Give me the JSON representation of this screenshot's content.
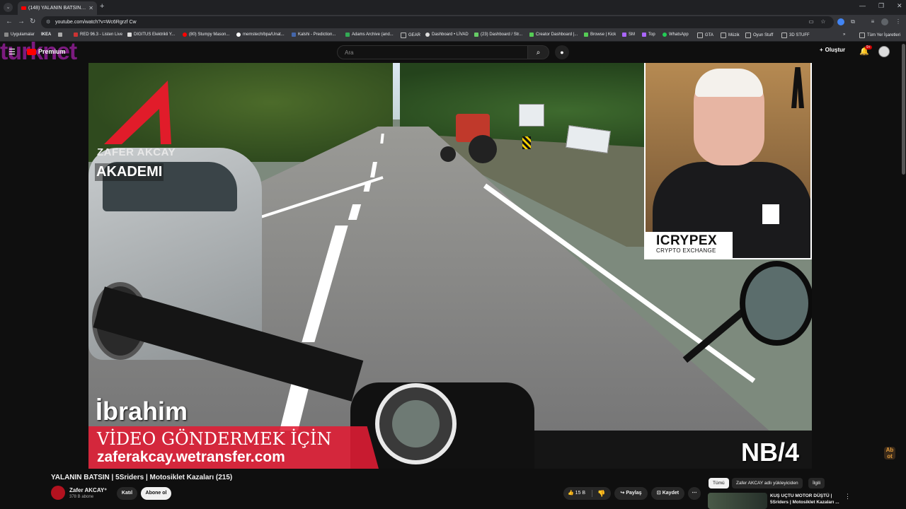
{
  "browser": {
    "tab_title": "(148) YALANIN BATSIN | 5Sr...",
    "url": "youtube.com/watch?v=Wc6Rgrzf Cw",
    "bookmarks": [
      "Uygulamalar",
      "IKEA",
      "",
      "RED 96.3 - Listen Live",
      "DIGITUS Elektrikli Y...",
      "(80) Stumpy Mason...",
      "memstech/bpa/Unat...",
      "Kalshi - Prediction...",
      "Adams Archive (and...",
      "GEAR",
      "Dashboard • LİVAD",
      "(23) Dashboard / Str...",
      "Creator Dashboard |...",
      "Browse | Kick",
      "SM",
      "Top",
      "WhatsApp",
      "GTA",
      "Müzik",
      "Oyun Stuff",
      "3D STUFF"
    ],
    "bookmarks_other": "Tüm Yer İşaretleri"
  },
  "youtube": {
    "watermark": "turknet",
    "logo_text": "Premium",
    "search_placeholder": "Ara",
    "create_label": "Oluştur",
    "notif_count": "9+"
  },
  "video_overlay": {
    "brand_sub": "ZAFER AKCAY",
    "brand_tag": "AKADEMI",
    "sponsor_main": "ICRYPEX",
    "sponsor_sub": "CRYPTO EXCHANGE",
    "caption_name": "İbrahim",
    "red_line1": "VİDEO GÖNDERMEK İÇİN",
    "red_line2": "zaferakcay.wetransfer.com",
    "episode_code": "NB/4",
    "side_watermark": "Ab ot"
  },
  "video": {
    "title": "YALANIN BATSIN | 5Sriders | Motosiklet Kazaları (215)",
    "channel": "Zafer AKCAY",
    "subscribers": "378 B abone",
    "join_label": "Katıl",
    "subscribe_label": "Abone ol",
    "likes": "15 B",
    "share_label": "Paylaş",
    "save_label": "Kaydet"
  },
  "recommendations": {
    "chips": [
      "Tümü",
      "Zafer AKCAY adlı yükleyiciden",
      "İlgili"
    ],
    "first_title": "KUŞ UÇTU MOTOR DÜŞTÜ | 5Sriders | Motosiklet Kazaları ..."
  }
}
